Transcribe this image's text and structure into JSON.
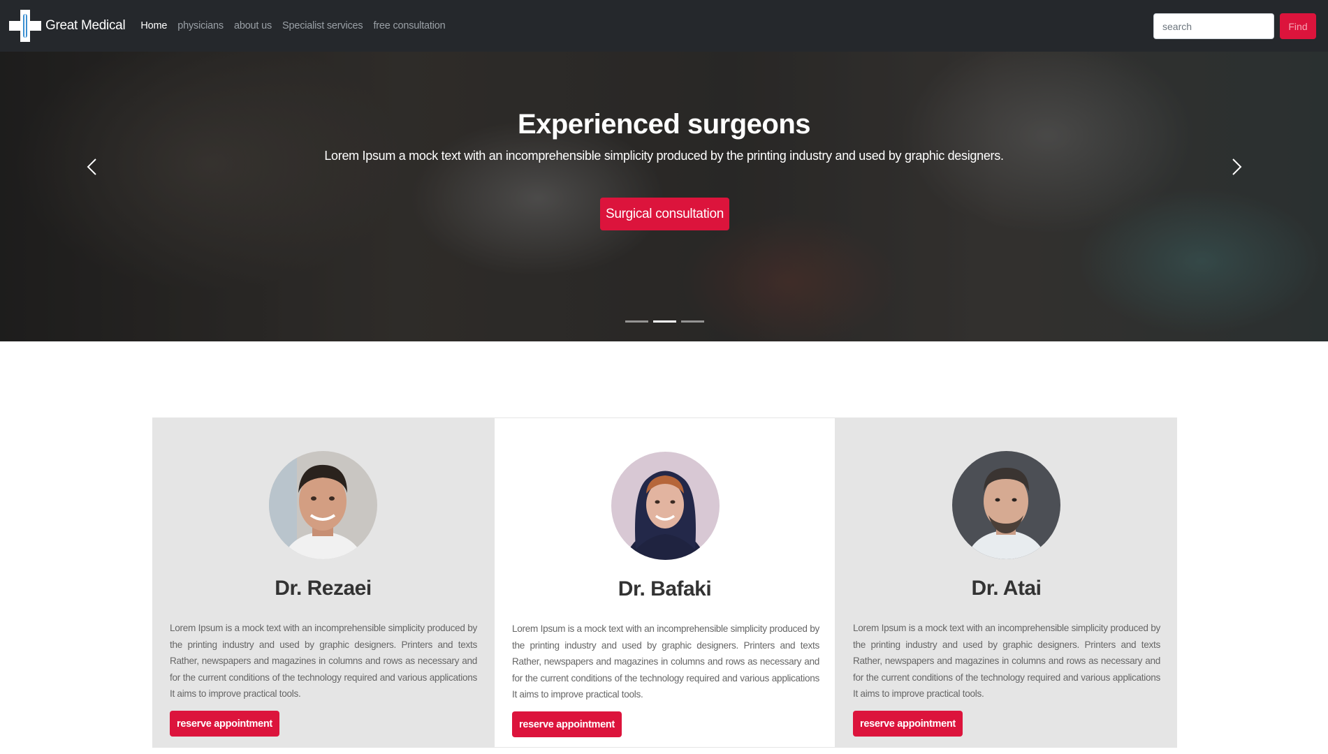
{
  "navbar": {
    "brand": "Great Medical",
    "links": [
      {
        "label": "Home",
        "active": true
      },
      {
        "label": "physicians",
        "active": false
      },
      {
        "label": "about us",
        "active": false
      },
      {
        "label": "Specialist services",
        "active": false
      },
      {
        "label": "free consultation",
        "active": false
      }
    ],
    "search": {
      "placeholder": "search",
      "value": ""
    },
    "find_label": "Find"
  },
  "hero": {
    "title": "Experienced surgeons",
    "text": "Lorem Ipsum a mock text with an incomprehensible simplicity produced by the printing industry and used by graphic designers.",
    "button_label": "Surgical consultation",
    "slide_count": 3,
    "active_slide": 2
  },
  "doctors": [
    {
      "name": "Dr. Rezaei",
      "description": "Lorem Ipsum is a mock text with an incomprehensible simplicity produced by the printing industry and used by graphic designers. Printers and texts Rather, newspapers and magazines in columns and rows as necessary and for the current conditions of the technology required and various applications It aims to improve practical tools.",
      "button_label": "reserve appointment"
    },
    {
      "name": "Dr. Bafaki",
      "description": "Lorem Ipsum is a mock text with an incomprehensible simplicity produced by the printing industry and used by graphic designers. Printers and texts Rather, newspapers and magazines in columns and rows as necessary and for the current conditions of the technology required and various applications It aims to improve practical tools.",
      "button_label": "reserve appointment"
    },
    {
      "name": "Dr. Atai",
      "description": "Lorem Ipsum is a mock text with an incomprehensible simplicity produced by the printing industry and used by graphic designers. Printers and texts Rather, newspapers and magazines in columns and rows as necessary and for the current conditions of the technology required and various applications It aims to improve practical tools.",
      "button_label": "reserve appointment"
    }
  ],
  "colors": {
    "navbar_bg": "#25282c",
    "accent": "#dc143c",
    "card_gray": "#e5e5e5"
  },
  "icons": {
    "logo": "medical-cross-icon",
    "prev": "chevron-left-icon",
    "next": "chevron-right-icon"
  }
}
